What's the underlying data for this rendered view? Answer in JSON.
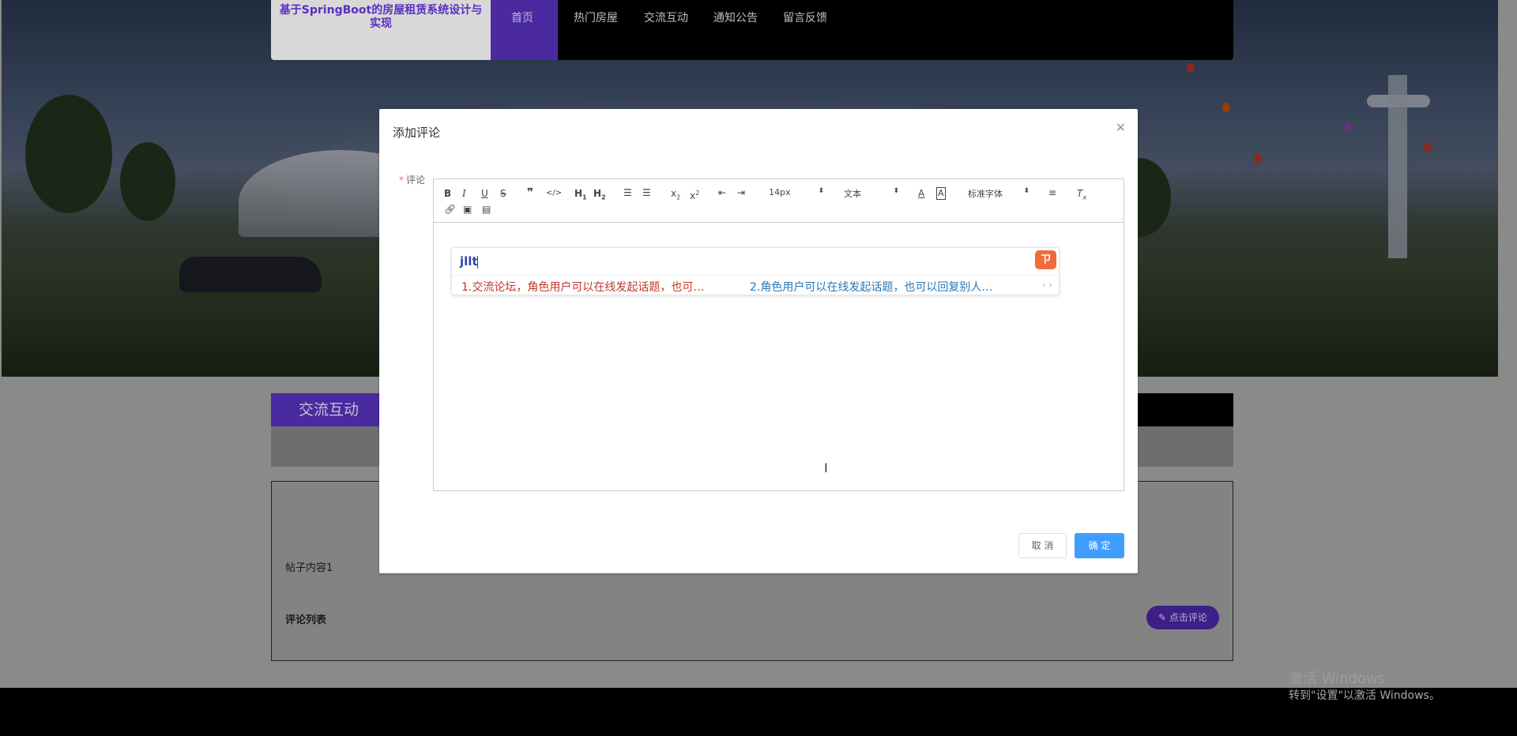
{
  "brand": {
    "title": "基于SpringBoot的房屋租赁系统设计与实现"
  },
  "nav": {
    "items": [
      "首页",
      "热门房屋",
      "交流互动",
      "通知公告",
      "留言反馈"
    ],
    "active": "首页"
  },
  "section": {
    "title": "交流互动"
  },
  "post": {
    "content": "帖子内容1",
    "comment_list_label": "评论列表",
    "comment_button": "点击评论"
  },
  "dialog": {
    "title": "添加评论",
    "field_label": "评论",
    "editor": {
      "font_size": "14px",
      "block_format": "文本",
      "font_family": "标准字体",
      "ime": {
        "input": "jllt",
        "candidates": [
          "1.交流论坛，角色用户可以在线发起话题，也可…",
          "2.角色用户可以在线发起话题，也可以回复别人…"
        ],
        "nav": "‹ ›"
      }
    },
    "cancel_label": "取 消",
    "ok_label": "确 定"
  },
  "watermark": {
    "line1": "激活 Windows",
    "line2": "转到\"设置\"以激活 Windows。"
  },
  "colors": {
    "accent": "#5a2fc2",
    "primary": "#409eff"
  }
}
